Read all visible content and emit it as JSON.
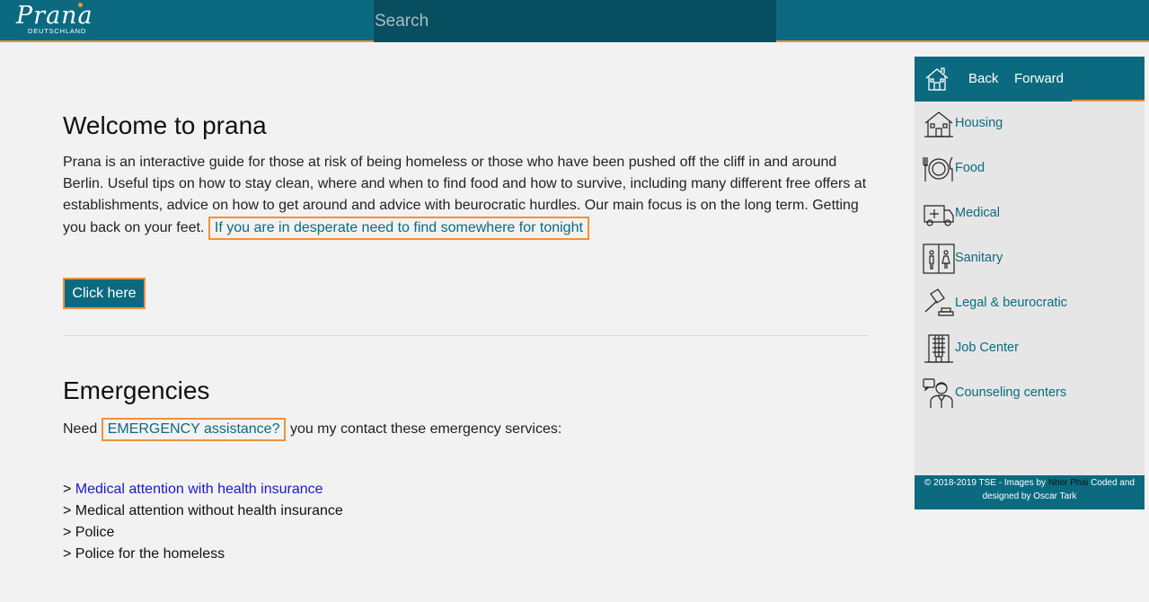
{
  "header": {
    "logo_text": "Prana",
    "logo_subtext": "DEUTSCHLAND",
    "search_placeholder": "Search"
  },
  "main": {
    "welcome_title": "Welcome to prana",
    "intro_text": "Prana is an interactive guide for those at risk of being homeless or those who have been pushed off the cliff in and around Berlin. Useful tips on how to stay clean, where and when to find food and how to survive, including many different free offers at establishments, advice on how to get around and advice with beurocratic hurdles. Our main focus is on the long term. Getting you back on your feet.",
    "tonight_link": "If you are in desperate need to find somewhere for tonight",
    "click_button": "Click here",
    "emergencies_title": "Emergencies",
    "need_prefix": "Need",
    "emergency_link": "EMERGENCY assistance?",
    "need_suffix": "you my contact these emergency services:",
    "services": [
      {
        "prefix": ">",
        "label": "Medical attention with health insurance",
        "link": true
      },
      {
        "prefix": ">",
        "label": "Medical attention without health insurance",
        "link": false
      },
      {
        "prefix": ">",
        "label": "Police",
        "link": false
      },
      {
        "prefix": ">",
        "label": "Police for the homeless",
        "link": false
      }
    ]
  },
  "sidebar": {
    "home_icon": "house-icon",
    "back_label": "Back",
    "forward_label": "Forward",
    "items": [
      {
        "label": "Housing",
        "icon": "housing-icon"
      },
      {
        "label": "Food",
        "icon": "food-icon"
      },
      {
        "label": "Medical",
        "icon": "ambulance-icon"
      },
      {
        "label": "Sanitary",
        "icon": "toilet-icon"
      },
      {
        "label": "Legal & beurocratic",
        "icon": "gavel-icon"
      },
      {
        "label": "Job Center",
        "icon": "office-building-icon"
      },
      {
        "label": "Counseling centers",
        "icon": "counselor-icon"
      }
    ],
    "footer": {
      "text_before": "© 2018-2019 TSE - Images by",
      "credit": "Nhor Phai",
      "text_after": "Coded and designed by Oscar Tark"
    }
  },
  "colors": {
    "primary": "#0b6a80",
    "primary_dark": "#074f60",
    "accent": "#f0913a",
    "background": "#f3f2f2",
    "sidebar_bg": "#e6e6e6",
    "link_blue": "#1a1ac9"
  }
}
